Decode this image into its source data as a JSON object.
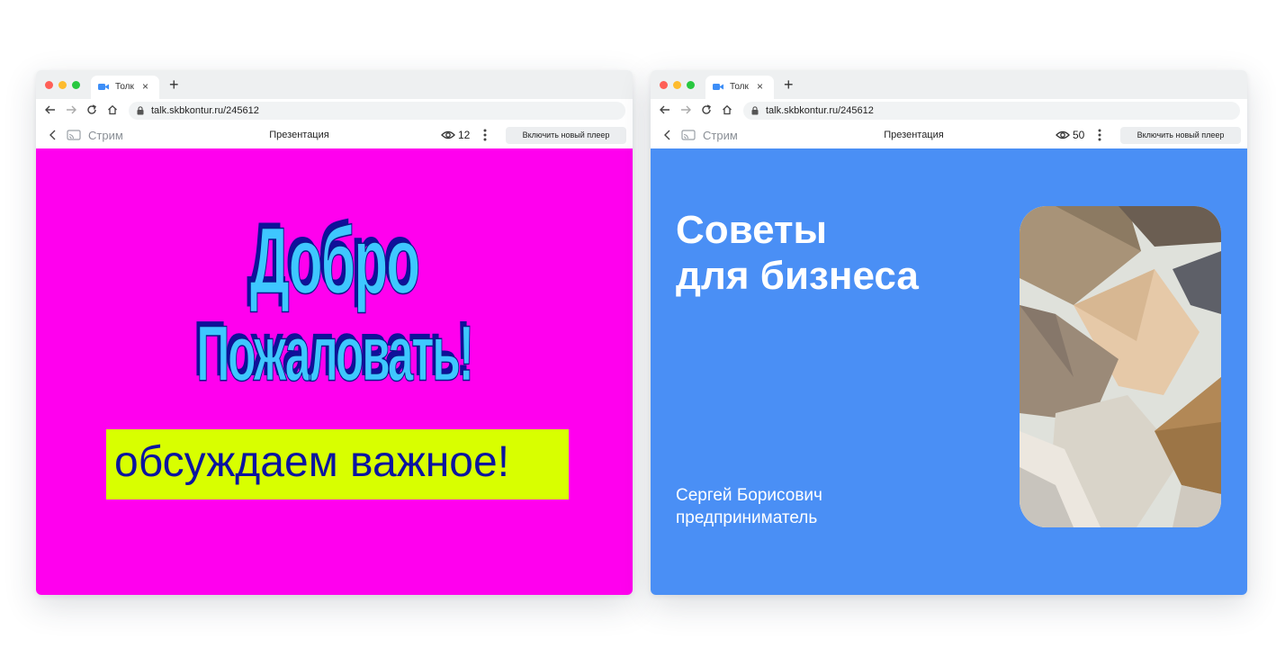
{
  "windows": [
    {
      "tab": {
        "title": "Толк",
        "close": "×"
      },
      "new_tab": "+",
      "url": "talk.skbkontur.ru/245612",
      "player": {
        "stream_label": "Стрим",
        "title": "Презентация",
        "viewers": "12",
        "button_label": "Включить новый плеер"
      },
      "slide": {
        "background": "#ff00ee",
        "headline_line1": "Добро",
        "headline_line2": "Пожаловать!",
        "subtitle": "обсуждаем важное!"
      }
    },
    {
      "tab": {
        "title": "Толк",
        "close": "×"
      },
      "new_tab": "+",
      "url": "talk.skbkontur.ru/245612",
      "player": {
        "stream_label": "Стрим",
        "title": "Презентация",
        "viewers": "50",
        "button_label": "Включить новый плеер"
      },
      "slide": {
        "background": "#4a8ff5",
        "title_line1": "Советы",
        "title_line2": "для бизнеса",
        "speaker_name": "Сергей Борисович",
        "speaker_role": "предприниматель",
        "image": "envelopes-photo"
      }
    }
  ],
  "colors": {
    "wordart_fill": "#3ec7ff",
    "wordart_shadow": "#10109a",
    "subtitle_box": "#d8ff00",
    "subtitle_text": "#0b14a0"
  }
}
